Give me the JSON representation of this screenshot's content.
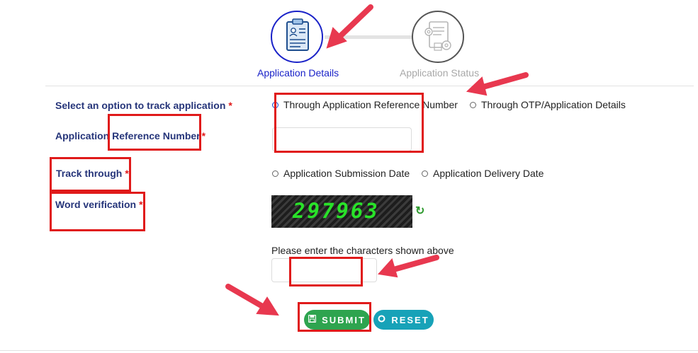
{
  "steps": [
    {
      "label": "Application Details",
      "icon": "resume-clipboard-icon"
    },
    {
      "label": "Application Status",
      "icon": "document-gears-icon"
    }
  ],
  "form": {
    "track_option_label": "Select an option to track application",
    "track_option_choices": [
      "Through Application Reference Number",
      "Through OTP/Application Details"
    ],
    "ref_number_label": "Application Reference Number",
    "ref_number_value": "",
    "track_through_label": "Track through",
    "track_through_choices": [
      "Application Submission Date",
      "Application Delivery Date"
    ],
    "word_verification_label": "Word verification",
    "captcha_text": "297963",
    "captcha_hint": "Please enter the characters shown above",
    "captcha_value": "",
    "required_mark": "*"
  },
  "buttons": {
    "submit": "SUBMIT",
    "reset": "RESET"
  },
  "colors": {
    "active_step": "#1a22c8",
    "label_text": "#26357a",
    "required": "#e01a1a",
    "submit": "#2ea44f",
    "reset": "#17a2b8",
    "annotation": "#e01a1a"
  }
}
